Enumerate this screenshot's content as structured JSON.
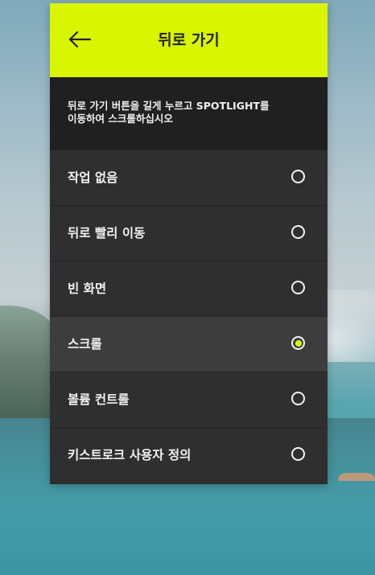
{
  "header": {
    "title": "뒤로 가기",
    "back_icon": "arrow-left-icon",
    "background_color": "#d9f500"
  },
  "description": {
    "line1": "뒤로 가기 버튼을 길게 누르고 SPOTLIGHT를",
    "line2": "이동하여 스크롤하십시오"
  },
  "options": [
    {
      "label": "작업 없음",
      "selected": false
    },
    {
      "label": "뒤로 빨리 이동",
      "selected": false
    },
    {
      "label": "빈 화면",
      "selected": false
    },
    {
      "label": "스크롤",
      "selected": true
    },
    {
      "label": "볼륨 컨트롤",
      "selected": false
    },
    {
      "label": "키스트로크 사용자 정의",
      "selected": false
    }
  ],
  "colors": {
    "accent": "#d9f500",
    "panel": "#2f2f2f",
    "selected_row": "#3d3d3d"
  }
}
